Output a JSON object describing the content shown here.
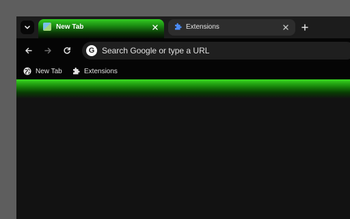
{
  "tabs": [
    {
      "title": "New Tab",
      "active": true,
      "favicon": "new-tab-favicon"
    },
    {
      "title": "Extensions",
      "active": false,
      "favicon": "puzzle-icon"
    }
  ],
  "omnibox": {
    "placeholder": "Search Google or type a URL"
  },
  "bookmarks": [
    {
      "label": "New Tab",
      "icon": "globe-icon"
    },
    {
      "label": "Extensions",
      "icon": "puzzle-icon"
    }
  ],
  "theme": {
    "accent": "#33cc22",
    "frame": "#1c1c1c",
    "toolbar": "#050505",
    "background": "#121212"
  }
}
